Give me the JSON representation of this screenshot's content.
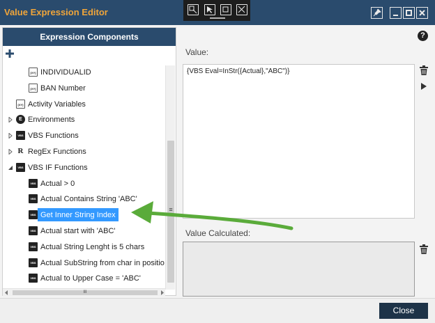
{
  "window": {
    "title": "Value Expression Editor"
  },
  "left_panel": {
    "header": "Expression Components",
    "tree": [
      {
        "label": "INDIVIDUALID",
        "icon": "text-variable-icon",
        "icon_text": "[XY]",
        "level": 2
      },
      {
        "label": "BAN Number",
        "icon": "text-variable-icon",
        "icon_text": "[XY]",
        "level": 2
      },
      {
        "label": "Activity Variables",
        "icon": "text-variable-icon",
        "icon_text": "[XY]",
        "level": 1
      },
      {
        "label": "Environments",
        "icon": "environment-icon",
        "icon_text": "E",
        "level": 1,
        "expander": "collapsed"
      },
      {
        "label": "VBS Functions",
        "icon": "vbs-icon",
        "icon_text": "VBS",
        "level": 1,
        "expander": "collapsed"
      },
      {
        "label": "RegEx Functions",
        "icon": "regex-icon",
        "icon_text": "R",
        "level": 1,
        "expander": "collapsed"
      },
      {
        "label": "VBS IF Functions",
        "icon": "vbs-icon",
        "icon_text": "VBS",
        "level": 1,
        "expander": "expanded"
      },
      {
        "label": "Actual > 0",
        "icon": "vbs-icon",
        "icon_text": "VBS",
        "level": 2
      },
      {
        "label": "Actual Contains String 'ABC'",
        "icon": "vbs-icon",
        "icon_text": "VBS",
        "level": 2
      },
      {
        "label": "Get Inner String Index",
        "icon": "vbs-icon",
        "icon_text": "VBS",
        "level": 2,
        "selected": true
      },
      {
        "label": "Actual start with 'ABC'",
        "icon": "vbs-icon",
        "icon_text": "VBS",
        "level": 2
      },
      {
        "label": "Actual String Lenght is 5 chars",
        "icon": "vbs-icon",
        "icon_text": "VBS",
        "level": 2
      },
      {
        "label": "Actual SubString from char in position",
        "icon": "vbs-icon",
        "icon_text": "VBS",
        "level": 2
      },
      {
        "label": "Actual to Upper Case = 'ABC'",
        "icon": "vbs-icon",
        "icon_text": "VBS",
        "level": 2
      }
    ],
    "scroll_grip": "≡",
    "hscroll_grip": "III"
  },
  "right_panel": {
    "value_label": "Value:",
    "value_text": "{VBS Eval=InStr({Actual},\"ABC\")}",
    "calculated_label": "Value Calculated:",
    "calculated_text": "",
    "help_symbol": "?"
  },
  "footer": {
    "close_label": "Close"
  },
  "colors": {
    "title_bar": "#2a4b6d",
    "title_text": "#f0a53a",
    "selection": "#3399ff",
    "annotation_arrow": "#5aab3a",
    "close_button": "#1e3348"
  }
}
